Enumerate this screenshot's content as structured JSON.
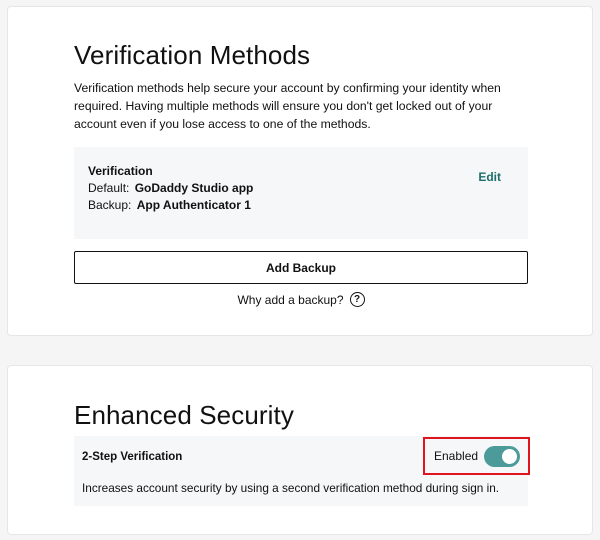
{
  "verification_methods": {
    "title": "Verification Methods",
    "intro": "Verification methods help secure your account by confirming your identity when required. Having multiple methods will ensure you don't get locked out of your account even if you lose access to one of the methods.",
    "box": {
      "heading": "Verification",
      "default_label": "Default:",
      "default_value": "GoDaddy Studio app",
      "backup_label": "Backup:",
      "backup_value": "App Authenticator 1",
      "edit_label": "Edit"
    },
    "add_backup_label": "Add Backup",
    "why_backup_label": "Why add a backup?",
    "help_icon_glyph": "?"
  },
  "enhanced_security": {
    "title": "Enhanced Security",
    "two_step": {
      "label": "2-Step Verification",
      "status_label": "Enabled",
      "enabled": true,
      "description": "Increases account security by using a second verification method during sign in."
    }
  },
  "colors": {
    "accent_teal": "#4c9a9a",
    "link_teal": "#1f6e6e",
    "highlight_red": "#e0141e",
    "panel_bg": "#f5f7f8"
  }
}
